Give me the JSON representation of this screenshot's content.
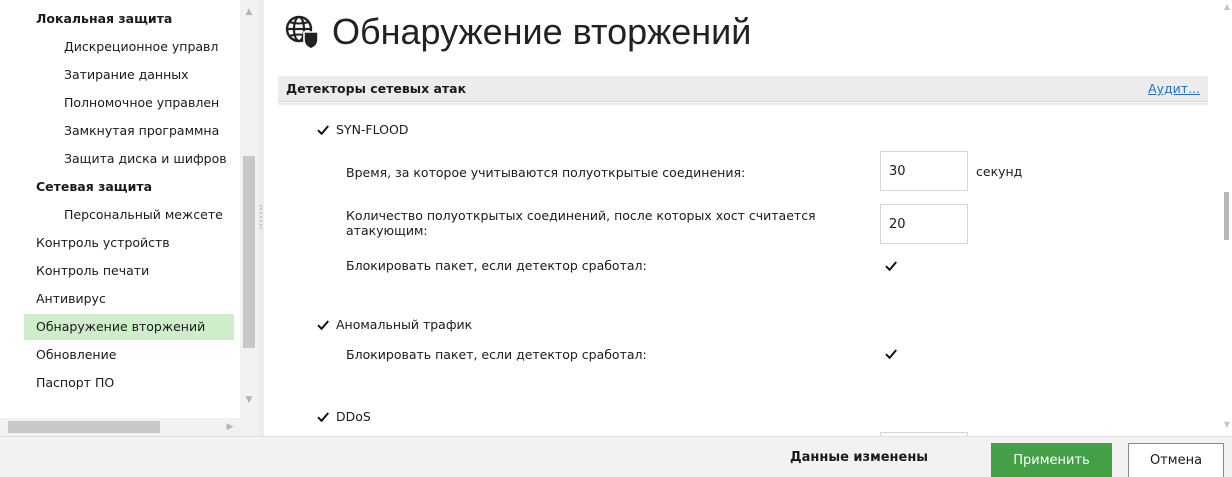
{
  "sidebar": {
    "items": [
      {
        "label": "Локальная защита"
      },
      {
        "label": "Дискреционное управл"
      },
      {
        "label": "Затирание данных"
      },
      {
        "label": "Полномочное управлен"
      },
      {
        "label": "Замкнутая программна"
      },
      {
        "label": "Защита диска и шифров"
      },
      {
        "label": "Сетевая защита"
      },
      {
        "label": "Персональный межсете"
      },
      {
        "label": "Контроль устройств"
      },
      {
        "label": "Контроль печати"
      },
      {
        "label": "Антивирус"
      },
      {
        "label": "Обнаружение вторжений"
      },
      {
        "label": "Обновление"
      },
      {
        "label": "Паспорт ПО"
      }
    ],
    "active_color": "#cfeccb"
  },
  "page": {
    "title": "Обнаружение вторжений",
    "title_icon": "globe-shield-icon"
  },
  "section": {
    "title": "Детекторы сетевых атак",
    "audit_link": "Аудит..."
  },
  "detectors": {
    "syn_flood": {
      "label": "SYN-FLOOD",
      "checked": true,
      "half_open_time_label": "Время, за которое учитываются полуоткрытые соединения:",
      "half_open_time_value": "30",
      "half_open_time_unit": "секунд",
      "half_open_count_label": "Количество полуоткрытых соединений, после которых хост считается атакующим:",
      "half_open_count_value": "20",
      "block_label": "Блокировать пакет, если детектор сработал:",
      "block_checked": true
    },
    "anomalous": {
      "label": "Аномальный трафик",
      "checked": true,
      "block_label": "Блокировать пакет, если детектор сработал:",
      "block_checked": true
    },
    "ddos": {
      "label": "DDoS",
      "checked": true
    }
  },
  "footer": {
    "status": "Данные изменены",
    "apply": "Применить",
    "cancel": "Отмена"
  },
  "colors": {
    "accent_green": "#44a047",
    "link_blue": "#1f6fd0"
  }
}
